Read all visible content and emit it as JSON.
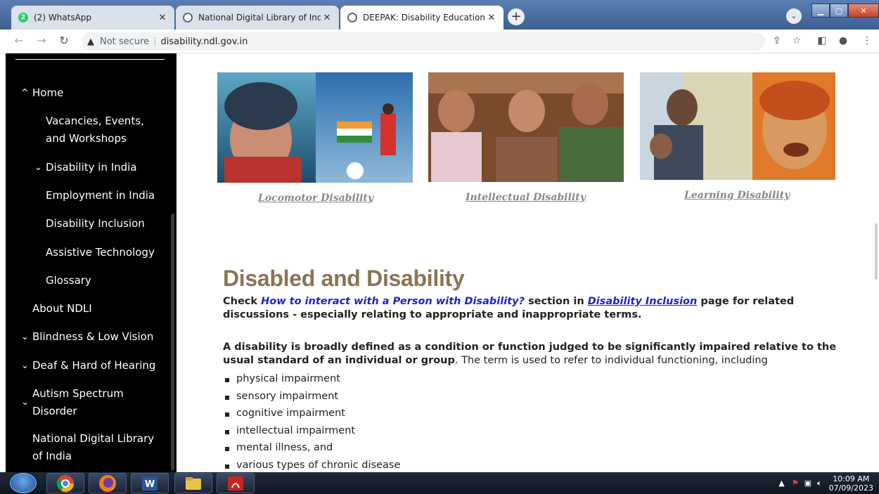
{
  "browser": {
    "tabs": [
      {
        "title": "(2) WhatsApp",
        "badge": "2",
        "color": "#25d366"
      },
      {
        "title": "National Digital Library of India",
        "color": "#6c7a8a"
      },
      {
        "title": "DEEPAK: Disability Education & E",
        "color": "#6c7a8a",
        "active": true
      }
    ],
    "address": {
      "security": "Not secure",
      "url": "disability.ndl.gov.in"
    }
  },
  "sidebar": {
    "home": "Home",
    "vacancies": "Vacancies, Events, and Workshops",
    "vacancies_line1": "Vacancies, Events,",
    "vacancies_line2": "and Workshops",
    "disability_india": "Disability in India",
    "employment": "Employment in India",
    "inclusion": "Disability Inclusion",
    "assistive": "Assistive Technology",
    "glossary": "Glossary",
    "about": "About NDLI",
    "blindness": "Blindness & Low Vision",
    "deaf": "Deaf & Hard of Hearing",
    "autism_line1": "Autism Spectrum",
    "autism_line2": "Disorder",
    "ndl_line1": "National Digital Library",
    "ndl_line2": "of India"
  },
  "gallery": {
    "locomotor": "Locomotor Disability",
    "intellectual": "Intellectual Disability",
    "learning": "Learning Disability"
  },
  "article": {
    "heading": "Disabled and Disability",
    "check_prefix": "Check ",
    "check_link": "How to interact with a Person with Disability?",
    "check_mid": " section in ",
    "inclusion_link": "Disability Inclusion",
    "check_suffix": " page for related",
    "check_line2": "discussions - especially relating to appropriate and inappropriate terms.",
    "def_bold_line1": "A disability is broadly defined as a condition or function judged to be significantly impaired relative to the",
    "def_bold_line2": "usual standard of an individual or group",
    "def_rest": ". The term is used to refer to individual functioning, including",
    "bullets": [
      "physical impairment",
      "sensory impairment",
      "cognitive impairment",
      "intellectual impairment",
      "mental illness, and",
      "various types of chronic disease"
    ]
  },
  "taskbar": {
    "time": "10:09 AM",
    "date": "07/09/2023"
  }
}
